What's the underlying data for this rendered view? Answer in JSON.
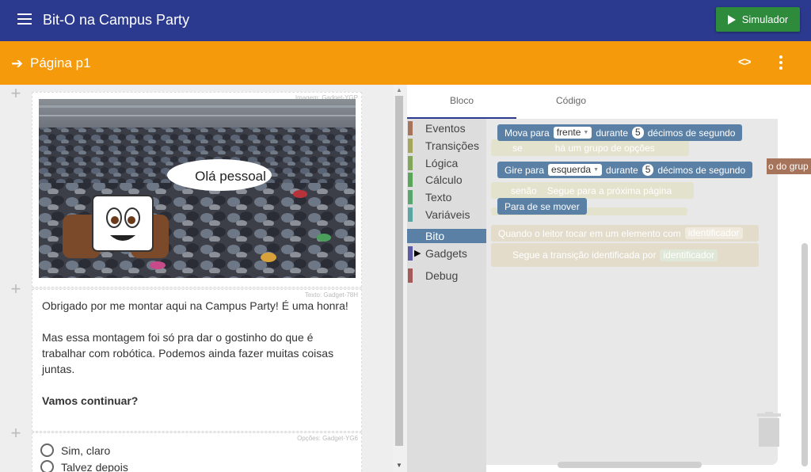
{
  "app": {
    "title": "Bit-O na Campus Party",
    "simulate_label": "Simulador"
  },
  "page_bar": {
    "title": "Página  p1"
  },
  "gadgets": {
    "image_tag": "Imagem: Gadget-YGP",
    "speech_bubble": "Olá pessoal",
    "text_tag": "Texto: Gadget-78H",
    "text_paragraph_1": "Obrigado por me montar aqui na Campus Party! É uma honra!",
    "text_paragraph_2": "Mas essa montagem foi só pra dar o gostinho do que é trabalhar com robótica. Podemos ainda fazer muitas coisas juntas.",
    "text_paragraph_3": "Vamos continuar?",
    "options_tag": "Opções: Gadget-YG6",
    "options": [
      "Sim, claro",
      "Talvez depois"
    ]
  },
  "editor": {
    "tabs": [
      "Bloco",
      "Código"
    ],
    "active_tab": "Bloco",
    "categories": [
      {
        "label": "Eventos",
        "color": "#a5745b"
      },
      {
        "label": "Transições",
        "color": "#a5a55b"
      },
      {
        "label": "Lógica",
        "color": "#80a55b"
      },
      {
        "label": "Cálculo",
        "color": "#5ba55b"
      },
      {
        "label": "Texto",
        "color": "#5ba573"
      },
      {
        "label": "Variáveis",
        "color": "#5ba5a5"
      },
      {
        "label": "Bito",
        "color": "#5b80a5"
      },
      {
        "label": "Gadgets",
        "color": "#5b5ba5"
      },
      {
        "label": "Debug",
        "color": "#a55b5b"
      }
    ],
    "selected_category": "Bito",
    "blocks": {
      "move_prefix": "Mova para",
      "move_dir": "frente",
      "move_during": "durante",
      "move_num": "5",
      "move_suffix": "décimos de segundo",
      "ghost_if": "se",
      "ghost_options": "há um grupo de opções",
      "turn_prefix": "Gire para",
      "turn_dir": "esquerda",
      "turn_during": "durante",
      "turn_num": "5",
      "turn_suffix": "décimos de segundo",
      "ghost_else": "senão",
      "ghost_next": "Segue para a próxima página",
      "stop": "Para de se mover",
      "ghost_event": "Quando o leitor tocar em um elemento com",
      "ghost_identifier": "identificador",
      "ghost_transition": "Segue a transição identificada por",
      "ghost_identifier2": "identificador",
      "peek_label": "o do grup"
    }
  }
}
